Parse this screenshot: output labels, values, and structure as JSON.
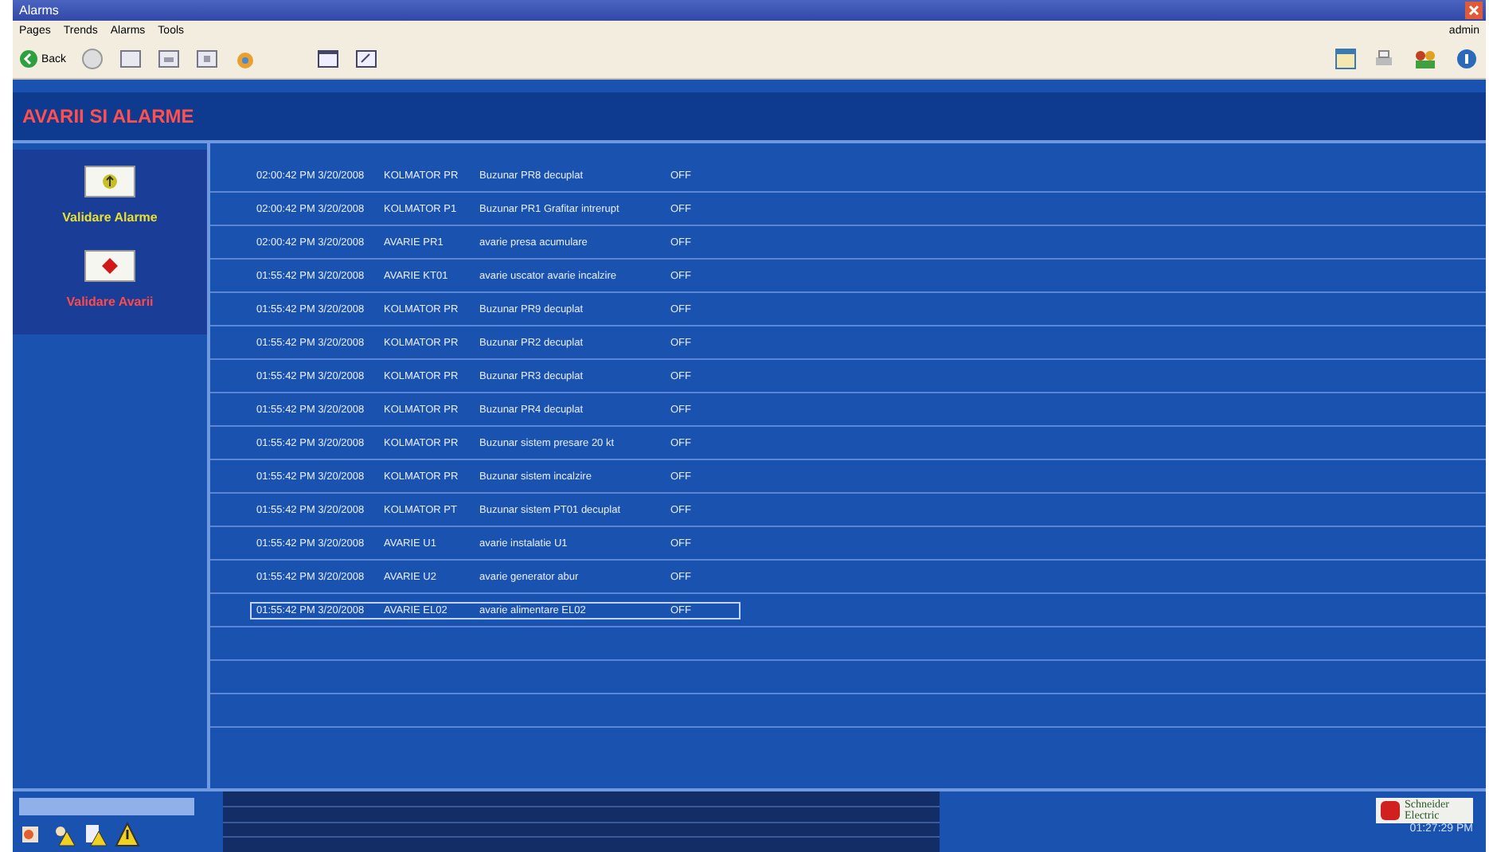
{
  "window": {
    "title": "Alarms"
  },
  "menu": [
    "Pages",
    "Trends",
    "Alarms",
    "Tools"
  ],
  "toolbar": {
    "back_label": "Back",
    "user": "admin"
  },
  "header": {
    "title": "AVARII SI ALARME"
  },
  "sidebar": {
    "buttons": [
      {
        "kind": "validate",
        "label": "Validare Alarme"
      },
      {
        "kind": "stop",
        "label": "Validare Avarii"
      }
    ]
  },
  "alarms": [
    {
      "time": "02:00:42 PM 3/20/2008",
      "tag": "KOLMATOR PR",
      "description": "Buzunar PR8 decuplat",
      "state": "OFF",
      "selected": false
    },
    {
      "time": "02:00:42 PM 3/20/2008",
      "tag": "KOLMATOR P1",
      "description": "Buzunar PR1 Grafitar intrerupt",
      "state": "OFF",
      "selected": false
    },
    {
      "time": "02:00:42 PM 3/20/2008",
      "tag": "AVARIE PR1",
      "description": "avarie presa acumulare",
      "state": "OFF",
      "selected": false
    },
    {
      "time": "01:55:42 PM 3/20/2008",
      "tag": "AVARIE KT01",
      "description": "avarie uscator avarie incalzire",
      "state": "OFF",
      "selected": false
    },
    {
      "time": "01:55:42 PM 3/20/2008",
      "tag": "KOLMATOR PR",
      "description": "Buzunar PR9 decuplat",
      "state": "OFF",
      "selected": false
    },
    {
      "time": "01:55:42 PM 3/20/2008",
      "tag": "KOLMATOR PR",
      "description": "Buzunar PR2 decuplat",
      "state": "OFF",
      "selected": false
    },
    {
      "time": "01:55:42 PM 3/20/2008",
      "tag": "KOLMATOR PR",
      "description": "Buzunar PR3 decuplat",
      "state": "OFF",
      "selected": false
    },
    {
      "time": "01:55:42 PM 3/20/2008",
      "tag": "KOLMATOR PR",
      "description": "Buzunar PR4 decuplat",
      "state": "OFF",
      "selected": false
    },
    {
      "time": "01:55:42 PM 3/20/2008",
      "tag": "KOLMATOR PR",
      "description": "Buzunar sistem presare 20 kt",
      "state": "OFF",
      "selected": false
    },
    {
      "time": "01:55:42 PM 3/20/2008",
      "tag": "KOLMATOR PR",
      "description": "Buzunar sistem incalzire",
      "state": "OFF",
      "selected": false
    },
    {
      "time": "01:55:42 PM 3/20/2008",
      "tag": "KOLMATOR PT",
      "description": "Buzunar sistem PT01 decuplat",
      "state": "OFF",
      "selected": false
    },
    {
      "time": "01:55:42 PM 3/20/2008",
      "tag": "AVARIE U1",
      "description": "avarie instalatie U1",
      "state": "OFF",
      "selected": false
    },
    {
      "time": "01:55:42 PM 3/20/2008",
      "tag": "AVARIE U2",
      "description": "avarie generator abur",
      "state": "OFF",
      "selected": false
    },
    {
      "time": "01:55:42 PM 3/20/2008",
      "tag": "AVARIE EL02",
      "description": "avarie alimentare EL02",
      "state": "OFF",
      "selected": true
    }
  ],
  "footer": {
    "logo_text": "Schneider Electric",
    "clock": "01:27:29 PM"
  }
}
